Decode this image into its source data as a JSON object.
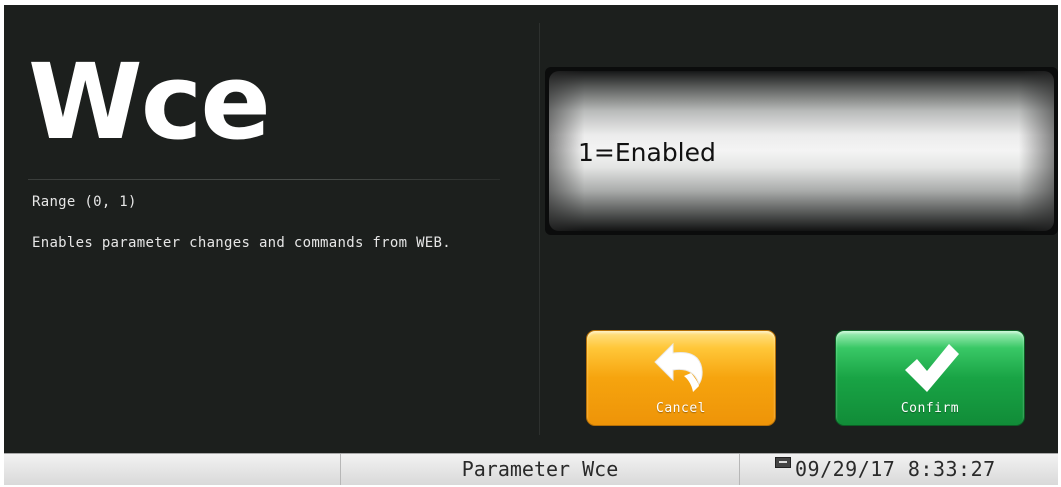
{
  "parameter": {
    "name": "Wce",
    "range": "Range (0, 1)",
    "description": "Enables parameter changes and commands from WEB."
  },
  "value": {
    "current": "1=Enabled"
  },
  "buttons": {
    "cancel_label": "Cancel",
    "cancel_icon": "undo-arrow-icon",
    "cancel_color": "#f6a40e",
    "confirm_label": "Confirm",
    "confirm_icon": "checkmark-icon",
    "confirm_color": "#19a445"
  },
  "status_bar": {
    "title": "Parameter Wce",
    "datetime": "09/29/17 8:33:27",
    "usb_icon": "usb-icon"
  }
}
